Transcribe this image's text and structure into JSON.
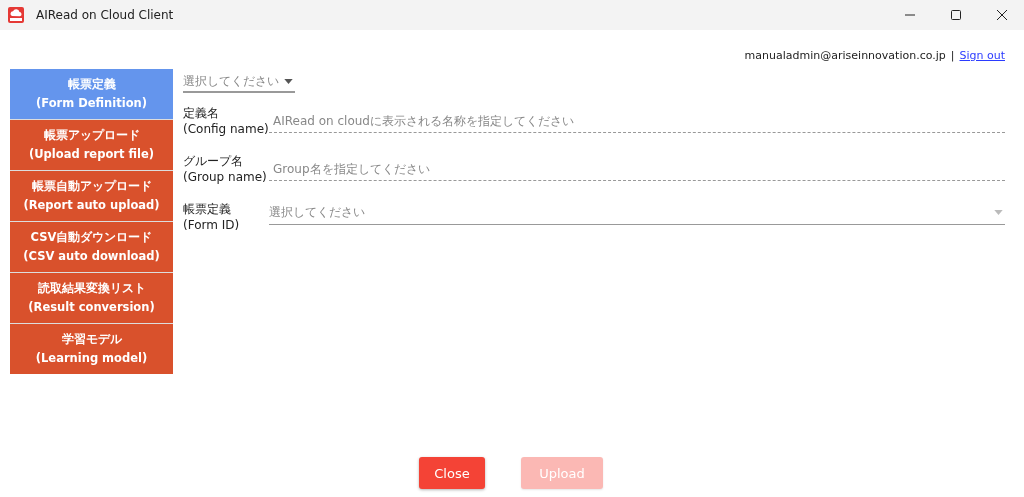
{
  "window": {
    "title": "AIRead on Cloud Client"
  },
  "account": {
    "email": "manualadmin@ariseinnovation.co.jp",
    "separator": "|",
    "sign_out": "Sign out"
  },
  "sidebar": {
    "items": [
      {
        "label": "帳票定義",
        "sublabel": "(Form Definition)",
        "selected": true
      },
      {
        "label": "帳票アップロード",
        "sublabel": "(Upload report file)",
        "selected": false
      },
      {
        "label": "帳票自動アップロード",
        "sublabel": "(Report auto upload)",
        "selected": false
      },
      {
        "label": "CSV自動ダウンロード",
        "sublabel": "(CSV auto download)",
        "selected": false
      },
      {
        "label": "読取結果変換リスト",
        "sublabel": "(Result conversion)",
        "selected": false
      },
      {
        "label": "学習モデル",
        "sublabel": "(Learning model)",
        "selected": false
      }
    ]
  },
  "top_select": {
    "placeholder": "選択してください"
  },
  "fields": [
    {
      "kind": "text",
      "label": "定義名",
      "sublabel": "(Config name)",
      "placeholder": "AIRead on cloudに表示される名称を指定してください"
    },
    {
      "kind": "text",
      "label": "グループ名",
      "sublabel": "(Group name)",
      "placeholder": "Group名を指定してください"
    },
    {
      "kind": "select",
      "label": "帳票定義",
      "sublabel": "(Form ID)",
      "placeholder": "選択してください"
    }
  ],
  "buttons": [
    {
      "label": "Close",
      "disabled": false
    },
    {
      "label": "Upload",
      "disabled": true
    }
  ]
}
